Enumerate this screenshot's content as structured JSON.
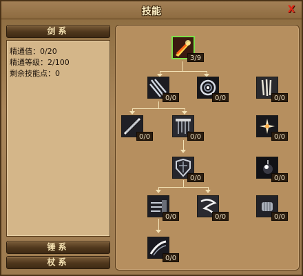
{
  "window": {
    "title": "技能",
    "close_label": "X"
  },
  "tabs": {
    "sword": "剑系",
    "hammer": "锤系",
    "staff": "杖系"
  },
  "info": {
    "mastery_value": "精通值：0/20",
    "mastery_level": "精通等级：2/100",
    "remaining_points": "剩余技能点：0"
  },
  "skills": [
    {
      "id": "root",
      "level": "3/9"
    },
    {
      "id": "r1a",
      "level": "0/0"
    },
    {
      "id": "r1b",
      "level": "0/0"
    },
    {
      "id": "r1c",
      "level": "0/0"
    },
    {
      "id": "r2a",
      "level": "0/0"
    },
    {
      "id": "r2b",
      "level": "0/0"
    },
    {
      "id": "r2c",
      "level": "0/0"
    },
    {
      "id": "r3a",
      "level": "0/0"
    },
    {
      "id": "r3b",
      "level": "0/0"
    },
    {
      "id": "r4a",
      "level": "0/0"
    },
    {
      "id": "r4b",
      "level": "0/0"
    },
    {
      "id": "r4c",
      "level": "0/0"
    },
    {
      "id": "r5a",
      "level": "0/0"
    }
  ]
}
